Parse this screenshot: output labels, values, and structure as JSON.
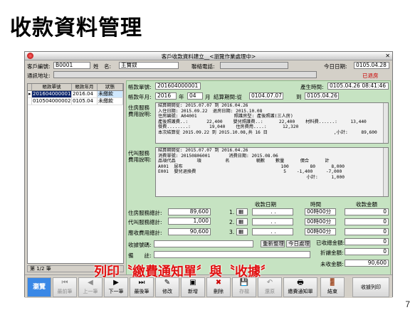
{
  "slide": {
    "title": "收款資料管理",
    "page_number": "7",
    "caption": "列印〝繳費通知單〞與〝收據〞"
  },
  "window": {
    "title": "客戶收款資料建立__<瀏覽作業處理中>"
  },
  "header": {
    "customer_no_label": "客戶編號:",
    "customer_no": "B0001",
    "name_label": "姓　名:",
    "name": "王寶釵",
    "phone_label": "聯絡電話:",
    "phone": "",
    "today_label": "今日日期:",
    "today": "0105.04.28",
    "address_label": "通訊地址:",
    "address": "",
    "status": "已退房"
  },
  "grid": {
    "columns": [
      "帳款單號",
      "帳款年月",
      "狀態"
    ],
    "rows": [
      [
        "201604000001",
        "2016.04",
        "未繳款"
      ],
      [
        "010504000002",
        "0105.04",
        "未繳款"
      ]
    ]
  },
  "detail": {
    "bill_no_label": "帳款單號:",
    "bill_no": "201604000001",
    "created_label": "產生時間:",
    "created": "0105.04.26 08:41:46",
    "ym_label": "帳款年月:",
    "year": "2016",
    "year_unit": "年",
    "month": "04",
    "month_unit": "月",
    "period_label": "結算期間:從",
    "period_from": "0104.07.07",
    "period_to_label": "到",
    "period_to": "0105.04.26",
    "stay_label_1": "住房服務",
    "stay_label_2": "費用說明:",
    "agency_label_1": "代叫服務",
    "agency_label_2": "費用說明:"
  },
  "stay_memo": [
    "結算期間從: 2015.07.07 到 2016.04.26",
    "入住日期: 2015.09.22  退房日期: 2015.10.08",
    "住房編號: A04001              照護房型: 產後照護(三人房)",
    "產後照護費..:       22,400    嬰兒照護費..:      22,400    材料費......:     13,440",
    "餐費........:       19,040    住房費用....:      12,320",
    "本次結算從 2015.09.22 到 2015.10.08,共 16 日                         ,小計:     89,600"
  ],
  "agency_memo": [
    "結算期間從: 2015.07.07 到 2016.04.26",
    "消費單號: 20150806001       消費日期: 2015.08.06",
    "",
    "品項代品        項         名          稱數    數量      價合      計",
    "",
    "A001  尿布                                     100        80      8,000",
    "E001  嬰兒退換費                                 5    -1,400     -7,000",
    "                                                        小計:     1,000"
  ],
  "totals": {
    "stay_total_label": "住房服務總計:",
    "stay_total": "89,600",
    "agency_total_label": "代叫服務總計:",
    "agency_total": "1,000",
    "payable_label": "應收費用總計:",
    "payable": "90,600"
  },
  "payments": {
    "date_header": "收款日期",
    "time_header": "時間",
    "amount_header": "收款金額",
    "rows": [
      {
        "idx": "1.",
        "date": ". .",
        "time": "00時00分",
        "amount": "0"
      },
      {
        "idx": "2.",
        "date": ". .",
        "time": "00時00分",
        "amount": "0"
      },
      {
        "idx": "3.",
        "date": ". .",
        "time": "00時00分",
        "amount": "0"
      }
    ],
    "received_label": "已收總金額:",
    "received": "0",
    "discount_label": "折讓金額:",
    "discount": "0",
    "unpaid_label": "未收金額:",
    "unpaid": "90,600"
  },
  "receipt": {
    "no_label": "收據號碼:",
    "no": "",
    "reorg_label": "重新整理",
    "today_btn": "今日處理",
    "note_label": "備　　註:",
    "note": ""
  },
  "recnav": {
    "text": "第 1/2 筆"
  },
  "toolbar": {
    "browse": "瀏覽",
    "first": "最前筆",
    "prev": "上一筆",
    "next": "下一筆",
    "last": "最後筆",
    "edit": "修改",
    "add": "新增",
    "delete": "刪除",
    "save": "存檔",
    "restore": "還原",
    "notice": "繳費通知單",
    "close": "結束",
    "print_receipt": "收據列印"
  }
}
